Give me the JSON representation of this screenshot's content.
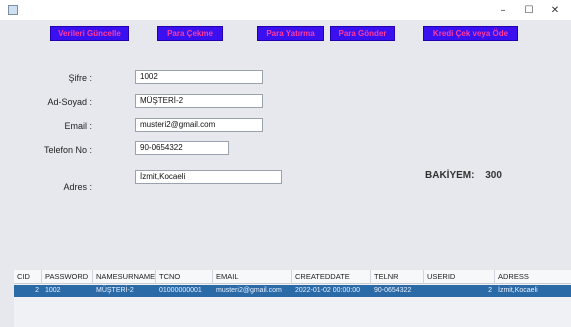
{
  "window": {
    "controls": {
      "minimize": "–",
      "maximize": "☐",
      "close": "✕"
    }
  },
  "toolbar": {
    "update_label": "Verileri Güncelle",
    "withdraw_label": "Para Çekme",
    "deposit_label": "Para Yatırma",
    "send_label": "Para Gönder",
    "credit_label": "Kredi Çek veya Öde"
  },
  "form": {
    "password_label": "Şifre :",
    "password_value": "1002",
    "name_label": "Ad-Soyad :",
    "name_value": "MÜŞTERİ-2",
    "email_label": "Email :",
    "email_value": "musteri2@gmail.com",
    "phone_label": "Telefon No :",
    "phone_value": "90-0654322",
    "address_label": "Adres :",
    "address_value": "İzmit,Kocaeli"
  },
  "balance": {
    "label": "BAKİYEM:",
    "value": "300"
  },
  "table": {
    "headers": [
      "CID",
      "PASSWORD",
      "NAMESURNAME",
      "TCNO",
      "EMAIL",
      "CREATEDDATE",
      "TELNR",
      "USERID",
      "ADRESS"
    ],
    "rows": [
      [
        "2",
        "1002",
        "MÜŞTERİ-2",
        "01000000001",
        "musteri2@gmail.com",
        "2022-01-02 00:00:00",
        "90-0654322",
        "2",
        "İzmit,Kocaeli"
      ]
    ]
  },
  "colors": {
    "button_bg": "#3a10f0",
    "button_text": "#ff3aa0",
    "selected_row": "#2a6aa6"
  }
}
